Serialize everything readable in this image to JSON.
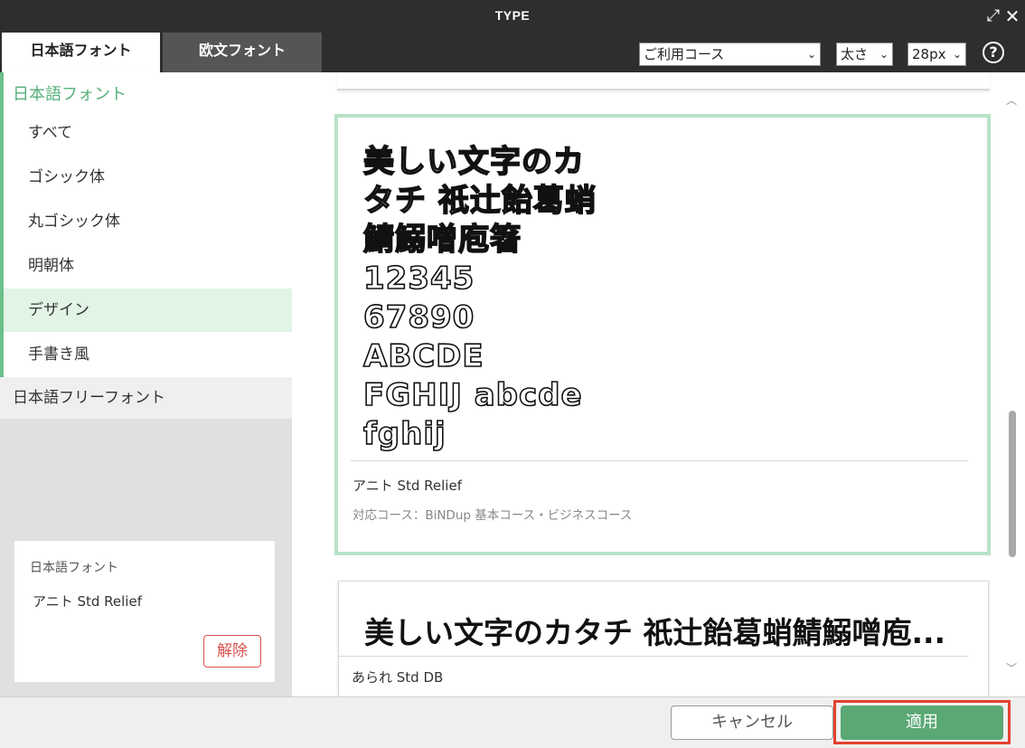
{
  "window": {
    "title": "TYPE",
    "expand_glyph": "⤢",
    "close_glyph": "✕"
  },
  "tabs": [
    {
      "label": "日本語フォント",
      "active": true
    },
    {
      "label": "欧文フォント",
      "active": false
    }
  ],
  "filters": {
    "course": {
      "value": "ご利用コース"
    },
    "weight": {
      "value": "太さ"
    },
    "size": {
      "value": "28px"
    },
    "chevron": "⌄",
    "help": "?"
  },
  "sidebar": {
    "heading": "日本語フォント",
    "items": [
      {
        "label": "すべて"
      },
      {
        "label": "ゴシック体"
      },
      {
        "label": "丸ゴシック体"
      },
      {
        "label": "明朝体"
      },
      {
        "label": "デザイン",
        "selected": true
      },
      {
        "label": "手書き風"
      }
    ],
    "free_fonts": "日本語フリーフォント",
    "selected_card": {
      "label": "日本語フォント",
      "font": "アニト Std Relief",
      "release_button": "解除"
    }
  },
  "cards": [
    {
      "sample_lines": [
        "美しい文字のカ",
        "タチ 祇辻飴葛蛸",
        "鯖鰯噌庖箸",
        "12345",
        "67890",
        "ABCDE",
        "FGHIJ abcde",
        "fghij"
      ],
      "font_name": "アニト Std Relief",
      "course": "対応コース：BiNDup 基本コース・ビジネスコース",
      "selected": true
    },
    {
      "sample": "美しい文字のカタチ 祇辻飴葛蛸鯖鰯噌庖...",
      "font_name": "あられ Std DB"
    }
  ],
  "scrollbar": {
    "up": "︿",
    "down": "﹀"
  },
  "footer": {
    "cancel": "キャンセル",
    "apply": "適用"
  },
  "colors": {
    "accent_green": "#5aa874",
    "selection_green": "#e1f4e6",
    "card_border": "#b8e2c7",
    "danger_red": "#d9534f",
    "highlight_ring": "#e4412f",
    "titlebar": "#2e2e2e"
  }
}
